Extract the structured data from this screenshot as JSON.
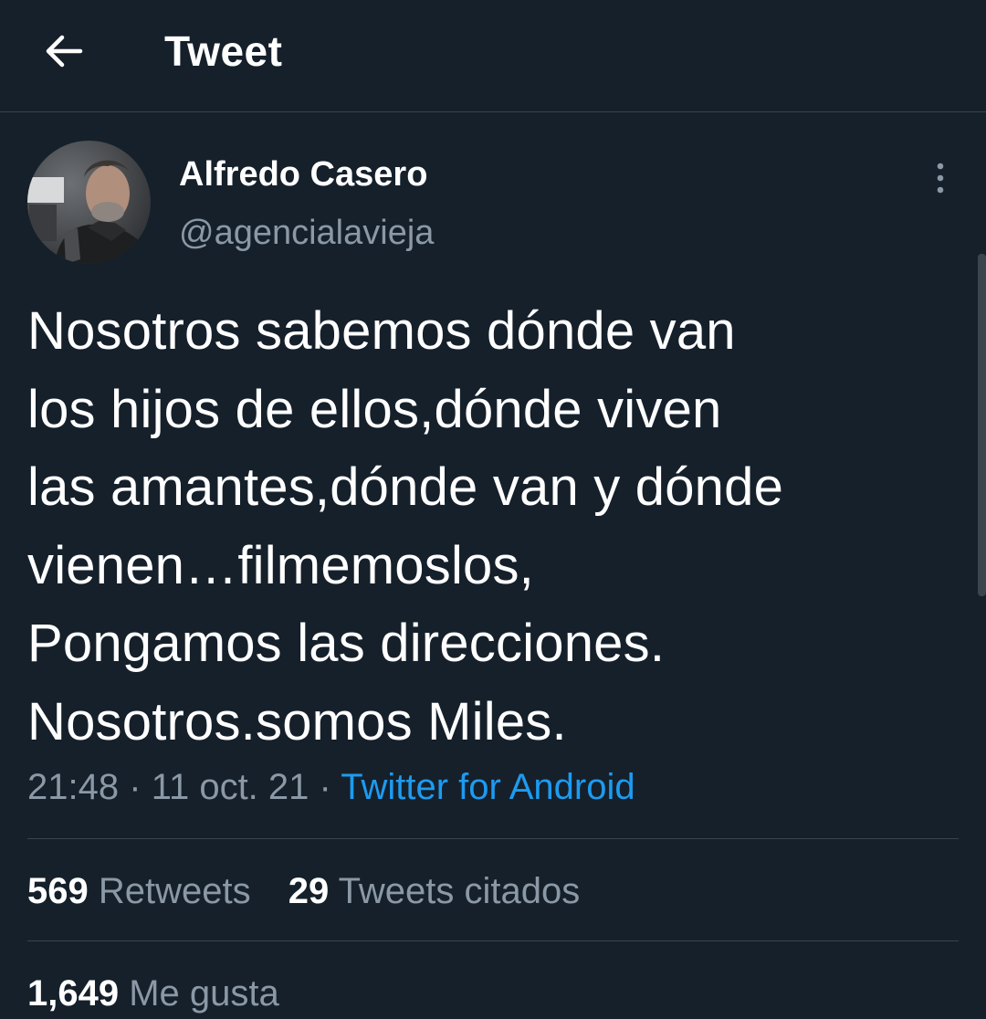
{
  "header": {
    "title": "Tweet",
    "back_icon": "arrow-left-icon"
  },
  "author": {
    "display_name": "Alfredo Casero",
    "handle": "@agencialavieja",
    "more_icon": "more-vertical-icon"
  },
  "tweet": {
    "lines": [
      "Nosotros sabemos dónde van",
      "los hijos de ellos,dónde viven",
      "las amantes,dónde van y dónde",
      "vienen…filmemoslos,",
      "Pongamos las direcciones.",
      "Nosotros.somos Miles."
    ]
  },
  "meta": {
    "time": "21:48",
    "separator": "·",
    "date": "11 oct. 21",
    "source": "Twitter for Android"
  },
  "stats": {
    "retweets_count": "569",
    "retweets_label": "Retweets",
    "quotes_count": "29",
    "quotes_label": "Tweets citados",
    "likes_count": "1,649",
    "likes_label": "Me gusta"
  },
  "colors": {
    "background": "#15202b",
    "text": "#ffffff",
    "secondary": "#8b98a5",
    "link": "#1d9bf0",
    "border": "#38444d"
  }
}
